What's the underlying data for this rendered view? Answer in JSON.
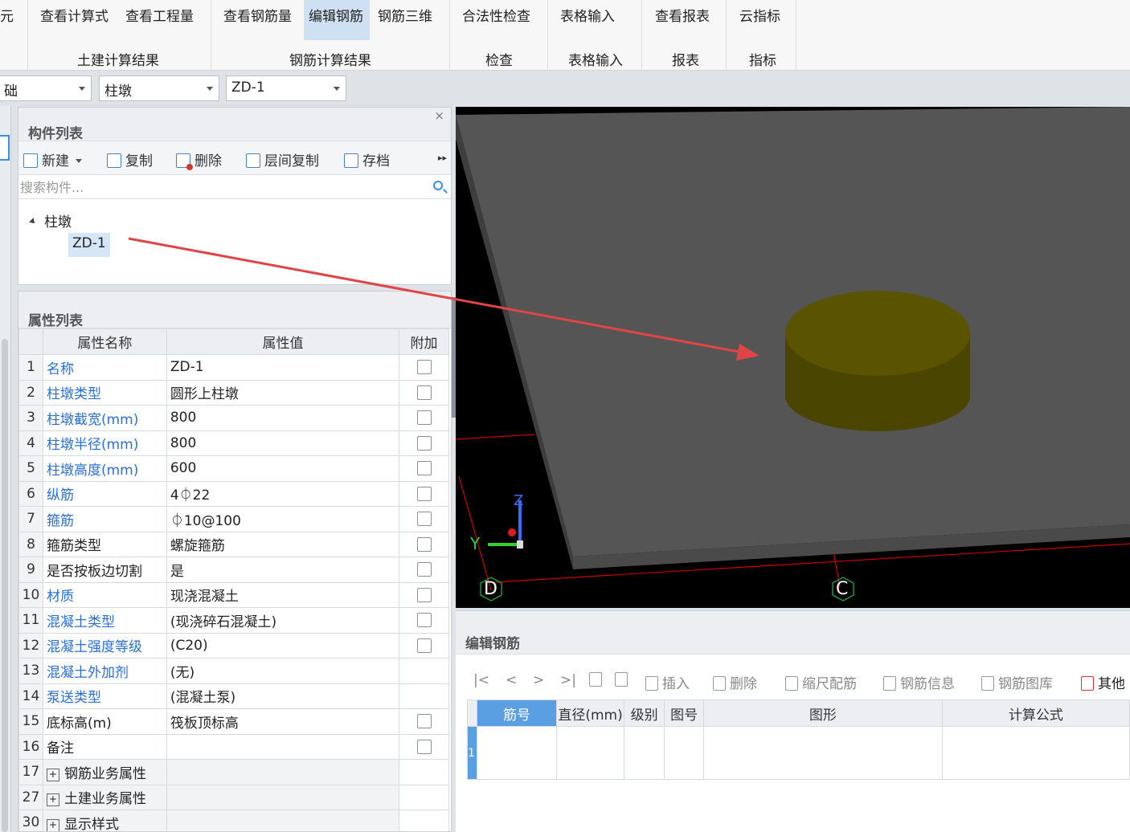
{
  "ribbon": {
    "buttons": {
      "yuan": "元",
      "view_formula": "查看计算式",
      "view_quantity": "查看工程量",
      "view_rebar_qty": "查看钢筋量",
      "edit_rebar": "编辑钢筋",
      "rebar_3d": "钢筋三维",
      "legality_check": "合法性检查",
      "table_input": "表格输入",
      "view_report": "查看报表",
      "cloud_index": "云指标"
    },
    "groups": {
      "civil_results": "土建计算结果",
      "rebar_results": "钢筋计算结果",
      "check": "检查",
      "table_input": "表格输入",
      "report": "报表",
      "index": "指标"
    }
  },
  "combos": {
    "floor": "础",
    "type": "柱墩",
    "component": "ZD-1"
  },
  "component_list": {
    "title": "构件列表",
    "close": "×",
    "toolbar": {
      "new": "新建",
      "copy": "复制",
      "delete": "删除",
      "floor_copy": "层间复制",
      "save": "存档",
      "more": "▸▸"
    },
    "search_placeholder": "搜索构件...",
    "tree": {
      "parent": "柱墩",
      "child": "ZD-1"
    }
  },
  "property_list": {
    "title": "属性列表",
    "headers": {
      "name": "属性名称",
      "value": "属性值",
      "extra": "附加"
    },
    "rows": [
      {
        "num": "1",
        "name": "名称",
        "value": "ZD-1",
        "blue": true,
        "check": true
      },
      {
        "num": "2",
        "name": "柱墩类型",
        "value": "圆形上柱墩",
        "blue": true,
        "check": true
      },
      {
        "num": "3",
        "name": "柱墩截宽(mm)",
        "value": "800",
        "blue": true,
        "check": true
      },
      {
        "num": "4",
        "name": "柱墩半径(mm)",
        "value": "800",
        "blue": true,
        "check": true
      },
      {
        "num": "5",
        "name": "柱墩高度(mm)",
        "value": "600",
        "blue": true,
        "check": true
      },
      {
        "num": "6",
        "name": "纵筋",
        "value": "4⏀22",
        "blue": true,
        "check": true
      },
      {
        "num": "7",
        "name": "箍筋",
        "value": "⏀10@100",
        "blue": true,
        "check": true
      },
      {
        "num": "8",
        "name": "箍筋类型",
        "value": "螺旋箍筋",
        "blue": false,
        "check": true
      },
      {
        "num": "9",
        "name": "是否按板边切割",
        "value": "是",
        "blue": false,
        "check": true
      },
      {
        "num": "10",
        "name": "材质",
        "value": "现浇混凝土",
        "blue": true,
        "check": true
      },
      {
        "num": "11",
        "name": "混凝土类型",
        "value": "(现浇碎石混凝土)",
        "blue": true,
        "check": true
      },
      {
        "num": "12",
        "name": "混凝土强度等级",
        "value": "(C20)",
        "blue": true,
        "check": true
      },
      {
        "num": "13",
        "name": "混凝土外加剂",
        "value": "(无)",
        "blue": true,
        "check": false
      },
      {
        "num": "14",
        "name": "泵送类型",
        "value": "(混凝土泵)",
        "blue": true,
        "check": false
      },
      {
        "num": "15",
        "name": "底标高(m)",
        "value": "筏板顶标高",
        "blue": false,
        "check": true
      },
      {
        "num": "16",
        "name": "备注",
        "value": "",
        "blue": false,
        "check": true
      }
    ],
    "groups": [
      {
        "num": "17",
        "name": "钢筋业务属性"
      },
      {
        "num": "27",
        "name": "土建业务属性"
      },
      {
        "num": "30",
        "name": "显示样式"
      }
    ]
  },
  "viewport": {
    "axis_z": "Z",
    "axis_y": "Y",
    "grid_d": "D",
    "grid_c": "C",
    "colors": {
      "slab": "#555555",
      "pier_top": "#5a5400",
      "pier_side": "#4a4500",
      "grid": "#cc0000",
      "arrow": "#e04545"
    }
  },
  "rebar_panel": {
    "title": "编辑钢筋",
    "toolbar": {
      "first": "|<",
      "prev": "<",
      "next": ">",
      "last": ">|",
      "insert": "插入",
      "delete": "删除",
      "scale": "缩尺配筋",
      "info": "钢筋信息",
      "library": "钢筋图库",
      "other": "其他"
    },
    "headers": [
      "筋号",
      "直径(mm)",
      "级别",
      "图号",
      "图形",
      "计算公式"
    ],
    "row1": "1"
  }
}
